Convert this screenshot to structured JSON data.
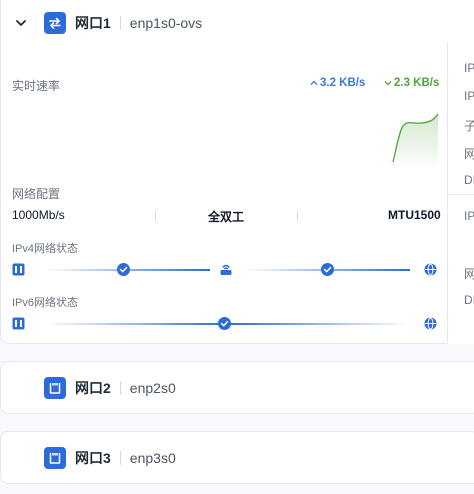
{
  "ports": [
    {
      "name": "网口1",
      "iface": "enp1s0-ovs",
      "expanded": true
    },
    {
      "name": "网口2",
      "iface": "enp2s0"
    },
    {
      "name": "网口3",
      "iface": "enp3s0"
    }
  ],
  "realtime": {
    "label": "实时速率",
    "upload": "3.2 KB/s",
    "download": "2.3 KB/s",
    "upload_color": "#3a7bd5",
    "download_color": "#52a33d"
  },
  "config": {
    "label": "网络配置",
    "speed": "1000Mb/s",
    "duplex": "全双工",
    "mtu": "MTU1500"
  },
  "ipv4": {
    "label": "IPv4网络状态"
  },
  "ipv6": {
    "label": "IPv6网络状态"
  },
  "side_labels": [
    "IP",
    "IP",
    "子",
    "网",
    "DI",
    "IP",
    "网",
    "DI"
  ],
  "colors": {
    "accent": "#2c6bd8",
    "border": "#e6eaf0"
  },
  "icons": {
    "collapse": "chevron-down-icon",
    "port1": "swap-arrows-icon",
    "port": "ethernet-port-icon",
    "interface": "network-interface-icon",
    "router": "router-icon",
    "internet": "globe-icon",
    "check": "check-icon"
  }
}
